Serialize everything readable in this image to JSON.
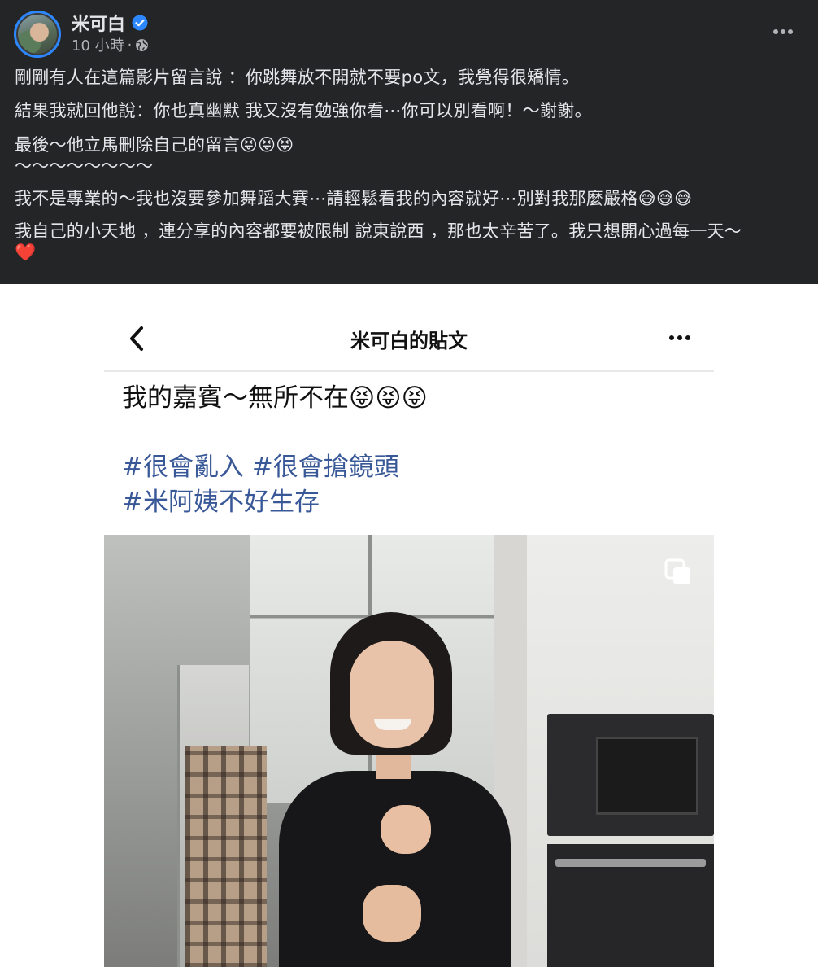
{
  "post": {
    "author": "米可白",
    "time": "10 小時",
    "separator": "·",
    "lines": [
      "剛剛有人在這篇影片留言說 ：你跳舞放不開就不要po文，我覺得很矯情。",
      "結果我就回他說：你也真幽默 我又沒有勉強你看⋯你可以別看啊！～謝謝。",
      "最後～他立馬刪除自己的留言😝😝😝",
      "～～～～～～～～",
      "我不是專業的～我也沒要參加舞蹈大賽⋯請輕鬆看我的內容就好⋯別對我那麼嚴格😅😅😅",
      "我自己的小天地 ，連分享的內容都要被限制 說東說西 ，那也太辛苦了。我只想開心過每一天～",
      "❤️"
    ]
  },
  "screenshot": {
    "title": "米可白的貼文",
    "caption": "我的嘉賓～無所不在😝😝😝",
    "hashtags": [
      "#很會亂入 #很會搶鏡頭",
      "#米阿姨不好生存"
    ]
  },
  "icons": {
    "verified": "verified-badge-icon",
    "audience": "globe-icon",
    "more": "more-horizontal-icon",
    "back": "chevron-left-icon",
    "multi_media": "copy-stack-icon"
  },
  "colors": {
    "dark_bg": "#242526",
    "verified_blue": "#2d88ff",
    "hashtag_blue": "#385898"
  }
}
